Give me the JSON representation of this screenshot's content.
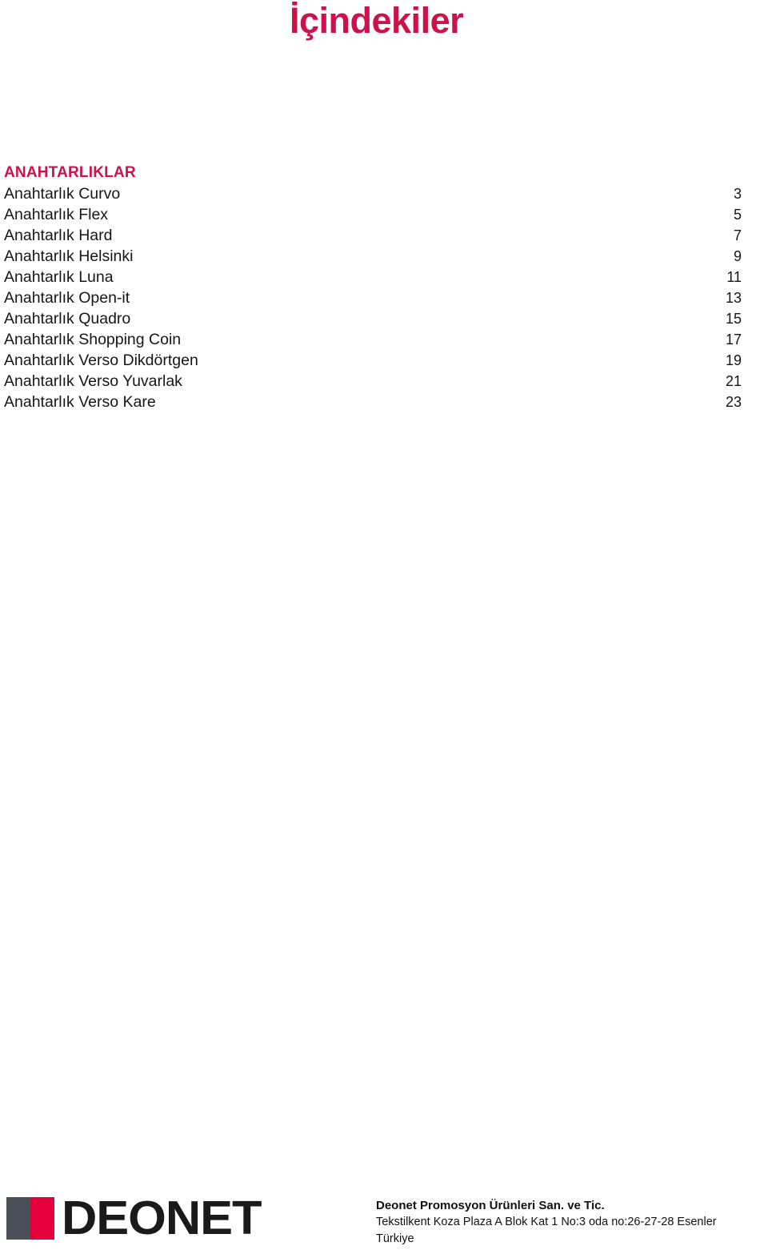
{
  "document": {
    "title": "İçindekiler"
  },
  "toc": {
    "section_heading": "ANAHTARLIKLAR",
    "entries": [
      {
        "label": "Anahtarlık Curvo",
        "page": "3"
      },
      {
        "label": "Anahtarlık Flex",
        "page": "5"
      },
      {
        "label": "Anahtarlık Hard",
        "page": "7"
      },
      {
        "label": "Anahtarlık Helsinki",
        "page": "9"
      },
      {
        "label": "Anahtarlık Luna",
        "page": "11"
      },
      {
        "label": "Anahtarlık Open-it",
        "page": "13"
      },
      {
        "label": "Anahtarlık Quadro",
        "page": "15"
      },
      {
        "label": "Anahtarlık Shopping Coin",
        "page": "17"
      },
      {
        "label": "Anahtarlık Verso Dikdörtgen",
        "page": "19"
      },
      {
        "label": "Anahtarlık Verso Yuvarlak",
        "page": "21"
      },
      {
        "label": "Anahtarlık Verso Kare",
        "page": "23"
      }
    ]
  },
  "footer": {
    "logo": {
      "wordmark": "DEONET",
      "square_gray_color": "#4a5058",
      "square_red_color": "#e3003c"
    },
    "company_name": "Deonet Promosyon Ürünleri San. ve Tic.",
    "company_address": "Tekstilkent Koza Plaza A Blok Kat 1 No:3 oda no:26-27-28 Esenler",
    "company_country": "Türkiye"
  },
  "colors": {
    "accent_crimson": "#cc1248",
    "logo_red": "#e3003c",
    "logo_gray": "#4a5058",
    "text_black": "#161616"
  }
}
